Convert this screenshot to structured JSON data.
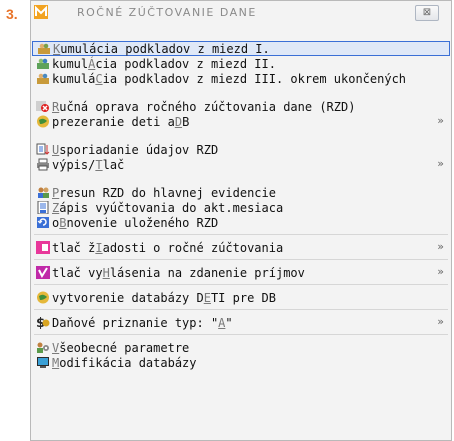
{
  "step_label": "3.",
  "window": {
    "title": "ROČNÉ ZÚČTOVANIE DANE",
    "close_glyph": "⊠"
  },
  "menu": {
    "group1": [
      {
        "pre": "",
        "hk": "K",
        "post": "umulácia podkladov z miezd I."
      },
      {
        "pre": "kumul",
        "hk": "Á",
        "post": "cia podkladov z miezd II."
      },
      {
        "pre": "kumulá",
        "hk": "C",
        "post": "ia podkladov z miezd III. okrem ukončených"
      }
    ],
    "group2": [
      {
        "pre": "",
        "hk": "R",
        "post": "učná oprava ročného zúčtovania dane (RZD)"
      },
      {
        "pre": "prezeranie deti a ",
        "hk": "D",
        "post": "B"
      }
    ],
    "group3": [
      {
        "pre": "",
        "hk": "U",
        "post": "sporiadanie údajov RZD"
      },
      {
        "pre": "výpis/",
        "hk": "T",
        "post": "lač"
      }
    ],
    "group4": [
      {
        "pre": "",
        "hk": "P",
        "post": "resun RZD do hlavnej evidencie"
      },
      {
        "pre": "",
        "hk": "Z",
        "post": "ápis vyúčtovania do akt.mesiaca"
      },
      {
        "pre": "o",
        "hk": "B",
        "post": "novenie uloženého RZD"
      }
    ],
    "item_ziadost": {
      "pre": "tlač ž",
      "hk": "I",
      "post": "adosti o ročné zúčtovania"
    },
    "item_vyhlasenie": {
      "pre": "tlač vy",
      "hk": "H",
      "post": "lásenia na zdanenie príjmov"
    },
    "item_deti_db": {
      "pre": "vytvorenie databázy D",
      "hk": "E",
      "post": "TI pre DB"
    },
    "item_danove": {
      "pre": "Daňové priznanie typ: \"",
      "hk": "A",
      "post": "\""
    },
    "group5": [
      {
        "pre": "",
        "hk": "V",
        "post": "šeobecné parametre"
      },
      {
        "pre": "",
        "hk": "M",
        "post": "odifikácia databázy"
      }
    ],
    "submenu_arrow": "»"
  }
}
